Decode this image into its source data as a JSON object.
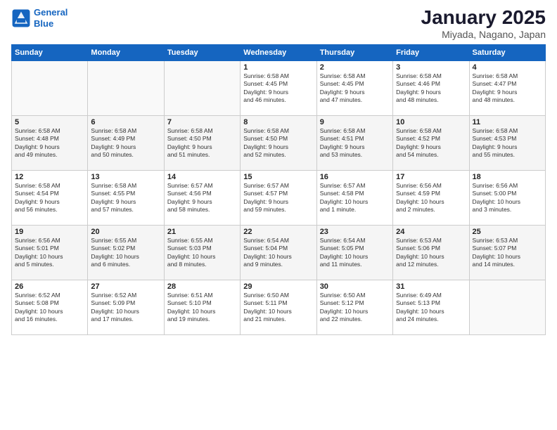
{
  "header": {
    "logo_line1": "General",
    "logo_line2": "Blue",
    "title": "January 2025",
    "subtitle": "Miyada, Nagano, Japan"
  },
  "weekdays": [
    "Sunday",
    "Monday",
    "Tuesday",
    "Wednesday",
    "Thursday",
    "Friday",
    "Saturday"
  ],
  "weeks": [
    [
      {
        "day": "",
        "info": ""
      },
      {
        "day": "",
        "info": ""
      },
      {
        "day": "",
        "info": ""
      },
      {
        "day": "1",
        "info": "Sunrise: 6:58 AM\nSunset: 4:45 PM\nDaylight: 9 hours\nand 46 minutes."
      },
      {
        "day": "2",
        "info": "Sunrise: 6:58 AM\nSunset: 4:45 PM\nDaylight: 9 hours\nand 47 minutes."
      },
      {
        "day": "3",
        "info": "Sunrise: 6:58 AM\nSunset: 4:46 PM\nDaylight: 9 hours\nand 48 minutes."
      },
      {
        "day": "4",
        "info": "Sunrise: 6:58 AM\nSunset: 4:47 PM\nDaylight: 9 hours\nand 48 minutes."
      }
    ],
    [
      {
        "day": "5",
        "info": "Sunrise: 6:58 AM\nSunset: 4:48 PM\nDaylight: 9 hours\nand 49 minutes."
      },
      {
        "day": "6",
        "info": "Sunrise: 6:58 AM\nSunset: 4:49 PM\nDaylight: 9 hours\nand 50 minutes."
      },
      {
        "day": "7",
        "info": "Sunrise: 6:58 AM\nSunset: 4:50 PM\nDaylight: 9 hours\nand 51 minutes."
      },
      {
        "day": "8",
        "info": "Sunrise: 6:58 AM\nSunset: 4:50 PM\nDaylight: 9 hours\nand 52 minutes."
      },
      {
        "day": "9",
        "info": "Sunrise: 6:58 AM\nSunset: 4:51 PM\nDaylight: 9 hours\nand 53 minutes."
      },
      {
        "day": "10",
        "info": "Sunrise: 6:58 AM\nSunset: 4:52 PM\nDaylight: 9 hours\nand 54 minutes."
      },
      {
        "day": "11",
        "info": "Sunrise: 6:58 AM\nSunset: 4:53 PM\nDaylight: 9 hours\nand 55 minutes."
      }
    ],
    [
      {
        "day": "12",
        "info": "Sunrise: 6:58 AM\nSunset: 4:54 PM\nDaylight: 9 hours\nand 56 minutes."
      },
      {
        "day": "13",
        "info": "Sunrise: 6:58 AM\nSunset: 4:55 PM\nDaylight: 9 hours\nand 57 minutes."
      },
      {
        "day": "14",
        "info": "Sunrise: 6:57 AM\nSunset: 4:56 PM\nDaylight: 9 hours\nand 58 minutes."
      },
      {
        "day": "15",
        "info": "Sunrise: 6:57 AM\nSunset: 4:57 PM\nDaylight: 9 hours\nand 59 minutes."
      },
      {
        "day": "16",
        "info": "Sunrise: 6:57 AM\nSunset: 4:58 PM\nDaylight: 10 hours\nand 1 minute."
      },
      {
        "day": "17",
        "info": "Sunrise: 6:56 AM\nSunset: 4:59 PM\nDaylight: 10 hours\nand 2 minutes."
      },
      {
        "day": "18",
        "info": "Sunrise: 6:56 AM\nSunset: 5:00 PM\nDaylight: 10 hours\nand 3 minutes."
      }
    ],
    [
      {
        "day": "19",
        "info": "Sunrise: 6:56 AM\nSunset: 5:01 PM\nDaylight: 10 hours\nand 5 minutes."
      },
      {
        "day": "20",
        "info": "Sunrise: 6:55 AM\nSunset: 5:02 PM\nDaylight: 10 hours\nand 6 minutes."
      },
      {
        "day": "21",
        "info": "Sunrise: 6:55 AM\nSunset: 5:03 PM\nDaylight: 10 hours\nand 8 minutes."
      },
      {
        "day": "22",
        "info": "Sunrise: 6:54 AM\nSunset: 5:04 PM\nDaylight: 10 hours\nand 9 minutes."
      },
      {
        "day": "23",
        "info": "Sunrise: 6:54 AM\nSunset: 5:05 PM\nDaylight: 10 hours\nand 11 minutes."
      },
      {
        "day": "24",
        "info": "Sunrise: 6:53 AM\nSunset: 5:06 PM\nDaylight: 10 hours\nand 12 minutes."
      },
      {
        "day": "25",
        "info": "Sunrise: 6:53 AM\nSunset: 5:07 PM\nDaylight: 10 hours\nand 14 minutes."
      }
    ],
    [
      {
        "day": "26",
        "info": "Sunrise: 6:52 AM\nSunset: 5:08 PM\nDaylight: 10 hours\nand 16 minutes."
      },
      {
        "day": "27",
        "info": "Sunrise: 6:52 AM\nSunset: 5:09 PM\nDaylight: 10 hours\nand 17 minutes."
      },
      {
        "day": "28",
        "info": "Sunrise: 6:51 AM\nSunset: 5:10 PM\nDaylight: 10 hours\nand 19 minutes."
      },
      {
        "day": "29",
        "info": "Sunrise: 6:50 AM\nSunset: 5:11 PM\nDaylight: 10 hours\nand 21 minutes."
      },
      {
        "day": "30",
        "info": "Sunrise: 6:50 AM\nSunset: 5:12 PM\nDaylight: 10 hours\nand 22 minutes."
      },
      {
        "day": "31",
        "info": "Sunrise: 6:49 AM\nSunset: 5:13 PM\nDaylight: 10 hours\nand 24 minutes."
      },
      {
        "day": "",
        "info": ""
      }
    ]
  ]
}
